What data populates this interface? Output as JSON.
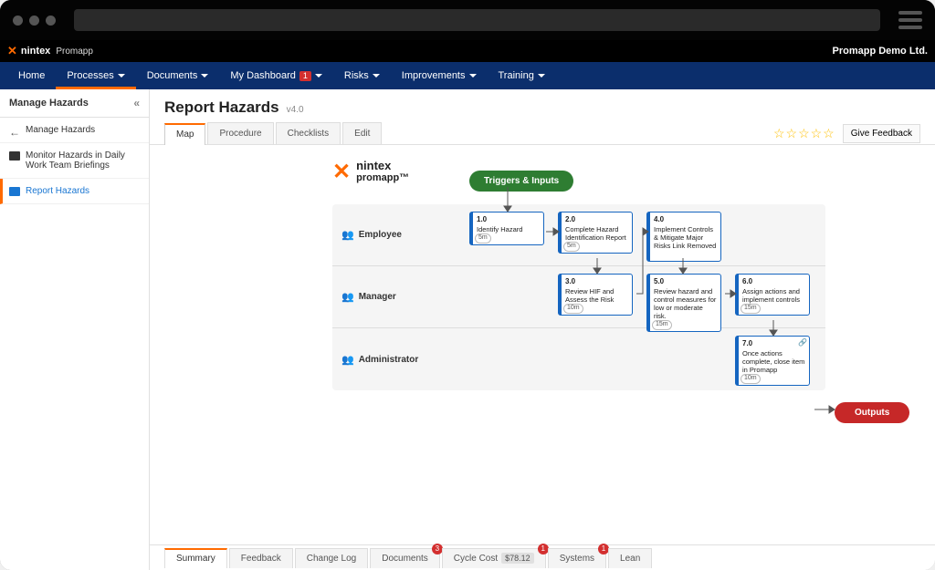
{
  "brand": {
    "name": "nintex",
    "sub": "Promapp"
  },
  "company": "Promapp Demo Ltd.",
  "nav": [
    {
      "label": "Home",
      "caret": false,
      "badge": null,
      "active": false
    },
    {
      "label": "Processes",
      "caret": true,
      "badge": null,
      "active": true
    },
    {
      "label": "Documents",
      "caret": true,
      "badge": null,
      "active": false
    },
    {
      "label": "My Dashboard",
      "caret": true,
      "badge": "1",
      "active": false
    },
    {
      "label": "Risks",
      "caret": true,
      "badge": null,
      "active": false
    },
    {
      "label": "Improvements",
      "caret": true,
      "badge": null,
      "active": false
    },
    {
      "label": "Training",
      "caret": true,
      "badge": null,
      "active": false
    }
  ],
  "sidebar": {
    "title": "Manage Hazards",
    "items": [
      {
        "icon": "back",
        "label": "Manage Hazards",
        "active": false
      },
      {
        "icon": "folder",
        "label": "Monitor Hazards in Daily Work Team Briefings",
        "active": false
      },
      {
        "icon": "doc",
        "label": "Report Hazards",
        "active": true
      }
    ]
  },
  "page": {
    "title": "Report Hazards",
    "version": "v4.0"
  },
  "tabs": [
    {
      "label": "Map",
      "active": true
    },
    {
      "label": "Procedure",
      "active": false
    },
    {
      "label": "Checklists",
      "active": false
    },
    {
      "label": "Edit",
      "active": false
    }
  ],
  "feedback_btn": "Give Feedback",
  "map": {
    "logo_brand": "nintex",
    "logo_sub": "promapp™",
    "trigger_label": "Triggers & Inputs",
    "outputs_label": "Outputs",
    "lanes": [
      {
        "role": "Employee"
      },
      {
        "role": "Manager"
      },
      {
        "role": "Administrator"
      }
    ],
    "steps": [
      {
        "id": "1.0",
        "text": "Identify Hazard",
        "time": "5m",
        "lane": 0,
        "col": 0
      },
      {
        "id": "2.0",
        "text": "Complete Hazard Identification Report",
        "time": "5m",
        "lane": 0,
        "col": 1
      },
      {
        "id": "4.0",
        "text": "Implement Controls & Mitigate Major Risks Link Removed",
        "time": "",
        "lane": 0,
        "col": 2
      },
      {
        "id": "3.0",
        "text": "Review HIF and Assess the Risk",
        "time": "10m",
        "lane": 1,
        "col": 1
      },
      {
        "id": "5.0",
        "text": "Review hazard and control measures for low or moderate risk.",
        "time": "15m",
        "lane": 1,
        "col": 2
      },
      {
        "id": "6.0",
        "text": "Assign actions and implement controls",
        "time": "15m",
        "lane": 1,
        "col": 3
      },
      {
        "id": "7.0",
        "text": "Once actions complete, close item in Promapp",
        "time": "10m",
        "lane": 2,
        "col": 3,
        "link": true
      }
    ]
  },
  "bottom_tabs": [
    {
      "label": "Summary",
      "active": true
    },
    {
      "label": "Feedback",
      "active": false
    },
    {
      "label": "Change Log",
      "active": false
    },
    {
      "label": "Documents",
      "active": false,
      "badge": "3"
    },
    {
      "label": "Cycle Cost",
      "active": false,
      "value": "$78.12",
      "badge": "1"
    },
    {
      "label": "Systems",
      "active": false,
      "badge": "1"
    },
    {
      "label": "Lean",
      "active": false
    }
  ]
}
